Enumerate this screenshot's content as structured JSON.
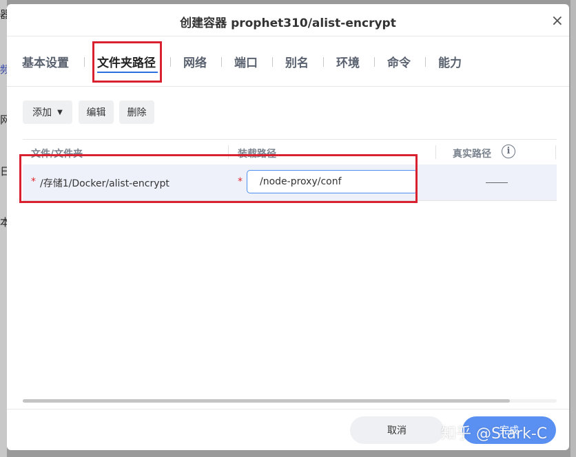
{
  "background": {
    "left_glyphs": [
      "器",
      "频",
      "网",
      "日",
      "本"
    ]
  },
  "dialog": {
    "title": "创建容器 prophet310/alist-encrypt",
    "close_symbol": "×"
  },
  "tabs": [
    {
      "label": "基本设置"
    },
    {
      "label": "文件夹路径"
    },
    {
      "label": "网络"
    },
    {
      "label": "端口"
    },
    {
      "label": "别名"
    },
    {
      "label": "环境"
    },
    {
      "label": "命令"
    },
    {
      "label": "能力"
    }
  ],
  "active_tab": "文件夹路径",
  "toolbar": {
    "add": "添加",
    "edit": "编辑",
    "delete": "删除"
  },
  "table": {
    "headers": {
      "file_folder": "文件/文件夹",
      "mount_path": "装载路径",
      "real_path": "真实路径"
    },
    "rows": [
      {
        "required_mark": "*",
        "file_folder": "/存储1/Docker/alist-encrypt",
        "mount_path": "/node-proxy/conf",
        "real_path": "——"
      }
    ]
  },
  "footer": {
    "cancel": "取消",
    "confirm": "完成"
  },
  "watermark": "知乎 @Stark-C",
  "colors": {
    "accent": "#2c6fde",
    "highlight_box": "#d8202e",
    "primary_button": "#5a90f2",
    "required": "#e0262e"
  }
}
